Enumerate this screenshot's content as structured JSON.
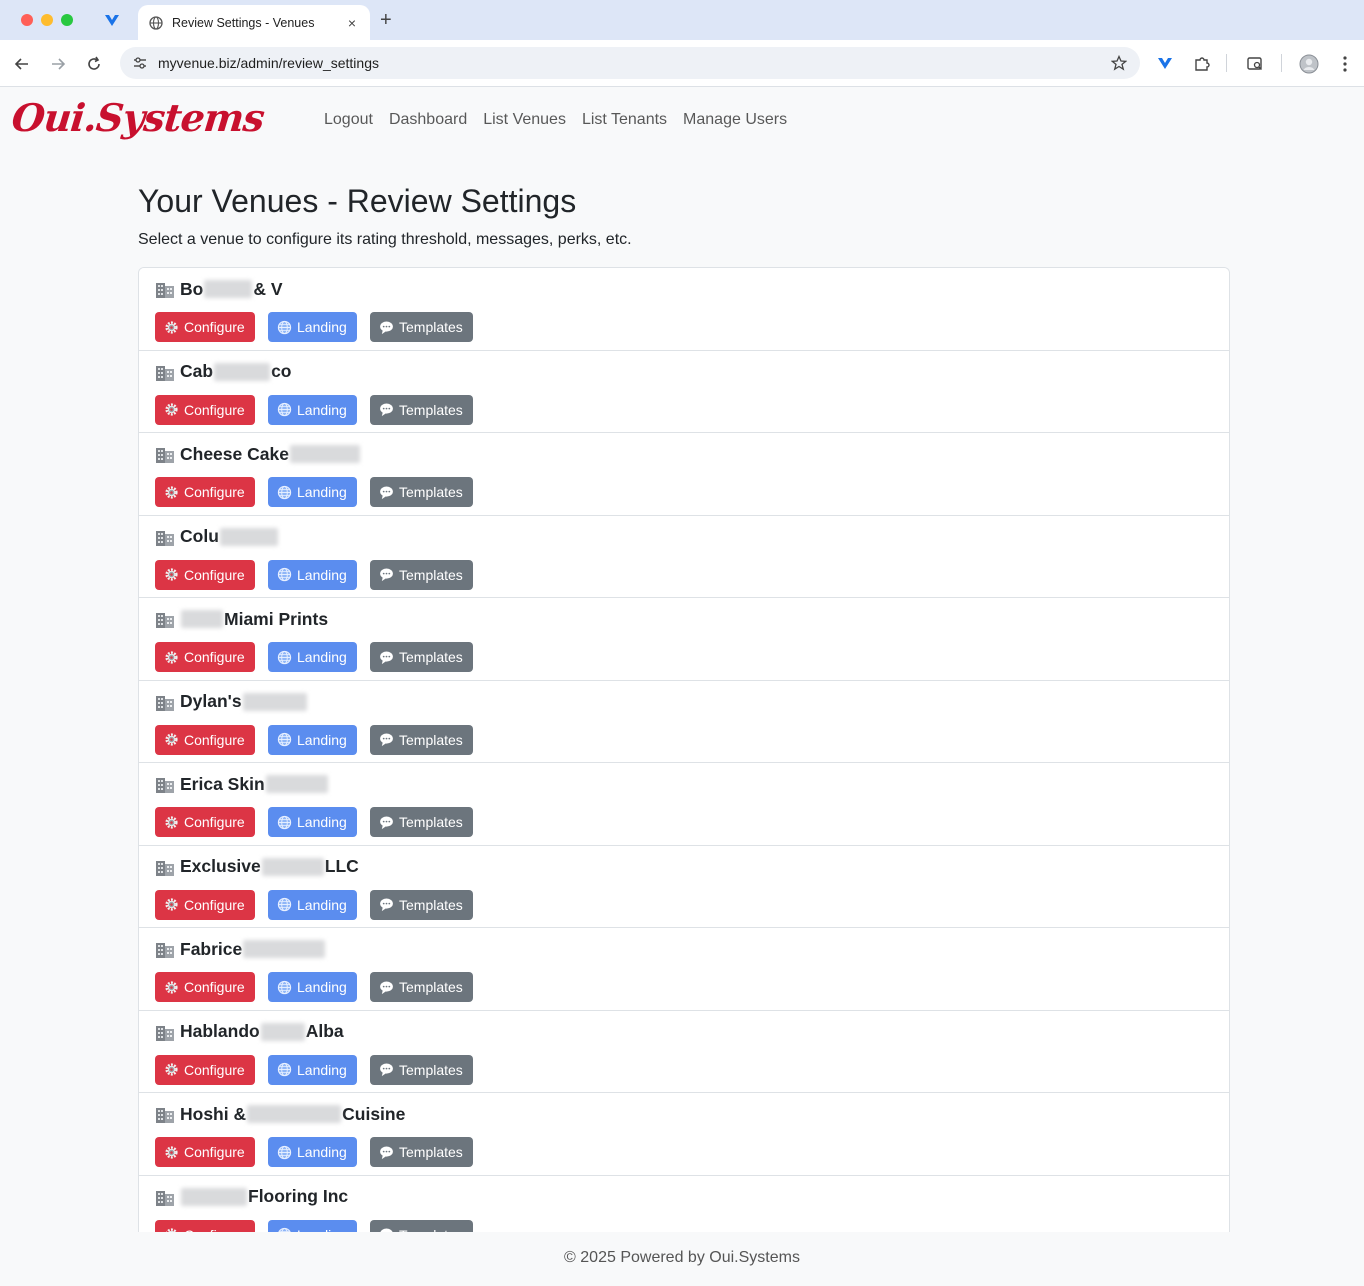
{
  "browser": {
    "tab_title": "Review Settings - Venues",
    "tab_close": "×",
    "new_tab": "+",
    "url": "myvenue.biz/admin/review_settings"
  },
  "brand": "Oui.Systems",
  "nav": {
    "logout": "Logout",
    "dashboard": "Dashboard",
    "list_venues": "List Venues",
    "list_tenants": "List Tenants",
    "manage_users": "Manage Users"
  },
  "main": {
    "title": "Your Venues - Review Settings",
    "subtitle": "Select a venue to configure its rating threshold, messages, perks, etc."
  },
  "buttons": {
    "configure": "Configure",
    "landing": "Landing",
    "templates": "Templates"
  },
  "venues": [
    {
      "name_start": "Bo",
      "name_end": "& V"
    },
    {
      "name_start": "Cab",
      "name_end": "co"
    },
    {
      "name_start": "Cheese Cake",
      "name_end": ""
    },
    {
      "name_start": "Colu",
      "name_end": ""
    },
    {
      "name_start": "",
      "name_end": "Miami Prints"
    },
    {
      "name_start": "Dylan's",
      "name_end": ""
    },
    {
      "name_start": "Erica Skin",
      "name_end": ""
    },
    {
      "name_start": "Exclusive",
      "name_end": "LLC"
    },
    {
      "name_start": "Fabrice",
      "name_end": ""
    },
    {
      "name_start": "Hablando",
      "name_end": "Alba"
    },
    {
      "name_start": "Hoshi &",
      "name_end": "Cuisine"
    },
    {
      "name_start": "",
      "name_end": "Flooring Inc"
    }
  ],
  "footer": "© 2025 Powered by Oui.Systems",
  "colors": {
    "configure": "#dc3545",
    "landing": "#5b8def",
    "templates": "#6c757d",
    "brand": "#c8102e"
  }
}
